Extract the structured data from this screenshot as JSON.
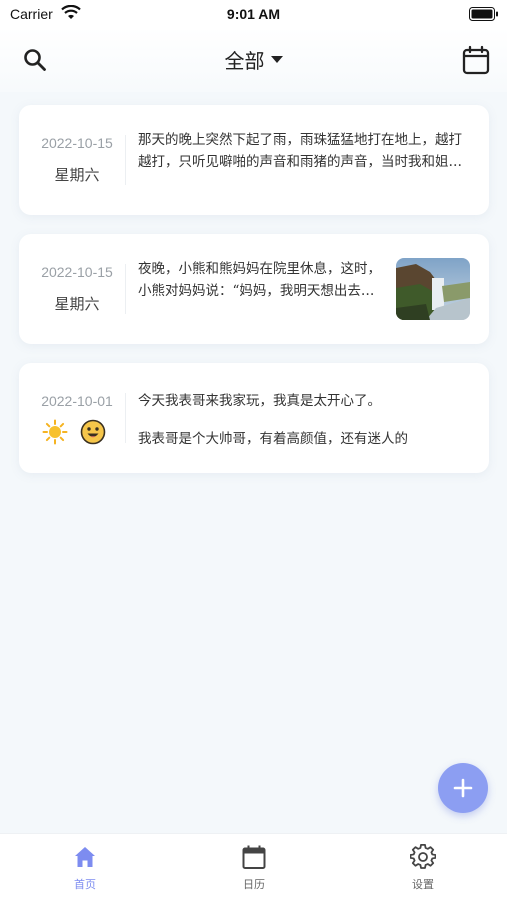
{
  "status": {
    "carrier": "Carrier",
    "time": "9:01 AM"
  },
  "header": {
    "title": "全部"
  },
  "entries": [
    {
      "date": "2022-10-15",
      "weekday": "星期六",
      "text": "那天的晚上突然下起了雨，雨珠猛猛地打在地上，越打越打，只听见噼啪的声音和雨猪的声音，当时我和姐姐在床上讲话。突然间"
    },
    {
      "date": "2022-10-15",
      "weekday": "星期六",
      "text": "夜晚，小熊和熊妈妈在院里休息，这时，小熊对妈妈说：“妈妈，我明天想出去散步，你能陪我去吗",
      "thumbnail": "waterfall-photo"
    },
    {
      "date": "2022-10-01",
      "weather_icon": "sun-icon",
      "mood_icon": "smile-emoji-icon",
      "line1": "今天我表哥来我家玩，我真是太开心了。",
      "line2": "我表哥是个大帅哥，有着高颜值，还有迷人的"
    }
  ],
  "tabs": [
    {
      "label": "首页",
      "icon": "home-icon",
      "active": true
    },
    {
      "label": "日历",
      "icon": "calendar-icon",
      "active": false
    },
    {
      "label": "设置",
      "icon": "settings-gear-icon",
      "active": false
    }
  ],
  "colors": {
    "accent": "#8c9ef2",
    "tab_active": "#7d8cf0",
    "background": "#f4f8fb"
  }
}
